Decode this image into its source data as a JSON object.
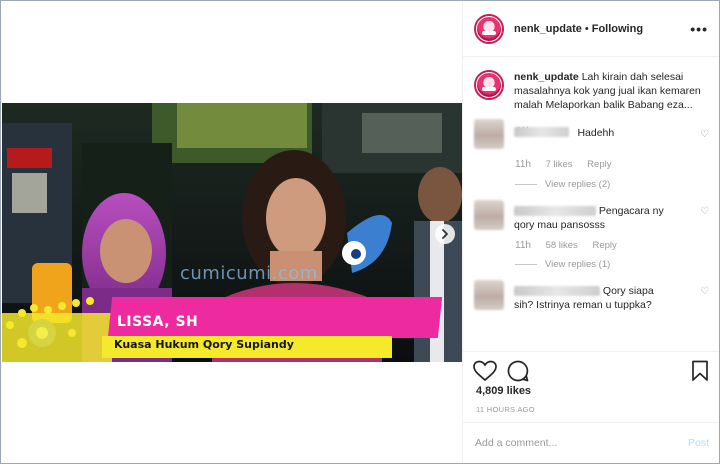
{
  "post": {
    "username": "nenk_update",
    "follow_status": "Following",
    "caption": "Lah kirain dah selesai masalahnya kok yang jual ikan kemaren malah Melaporkan balik Babang eza...",
    "caption_time": "11h",
    "likes": "4,809 likes",
    "time_ago": "11 HOURS AGO",
    "add_comment_placeholder": "Add a comment...",
    "post_button": "Post"
  },
  "comments": [
    {
      "text": "Hadehh",
      "time": "11h",
      "likes": "7 likes",
      "reply": "Reply",
      "view_replies": "View replies (2)"
    },
    {
      "text": "Pengacara ny qory mau pansosss",
      "time": "11h",
      "likes": "58 likes",
      "reply": "Reply",
      "view_replies": "View replies (1)"
    },
    {
      "text": "Qory siapa sih? Istrinya reman u tuppka?",
      "time": "",
      "likes": "",
      "reply": "",
      "view_replies": ""
    }
  ],
  "video": {
    "watermark": "cumicumi.com",
    "lower_third_name": "LISSA, SH",
    "lower_third_title": "Kuasa Hukum Qory Supiandy"
  },
  "icons": {
    "more": "more-horizontal-icon",
    "heart": "heart-icon",
    "comment": "comment-bubble-icon",
    "bookmark": "bookmark-icon",
    "next": "chevron-right-icon"
  },
  "colors": {
    "avatar_ring": "#c81e5a",
    "lower_third_magenta": "#ee2aa0",
    "lower_third_yellow": "#f5e92c",
    "post_button": "#b3dbff"
  }
}
